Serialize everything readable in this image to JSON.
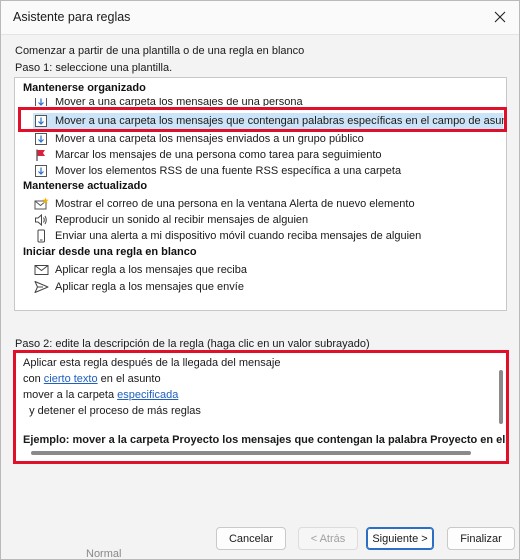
{
  "window": {
    "title": "Asistente para reglas"
  },
  "intro": "Comenzar a partir de una plantilla o de una regla en blanco",
  "step1": "Paso 1: seleccione una plantilla.",
  "groups": [
    {
      "header": "Mantenerse organizado"
    },
    {
      "header": "Mantenerse actualizado"
    },
    {
      "header": "Iniciar desde una regla en blanco"
    }
  ],
  "templates": [
    {
      "label": "Mover a una carpeta los mensajes de una persona",
      "icon": "envelope-arrow-icon"
    },
    {
      "label": "Mover a una carpeta los mensajes que contengan palabras específicas en el campo de asunto",
      "icon": "envelope-arrow-icon",
      "selected": true
    },
    {
      "label": "Mover a una carpeta los mensajes enviados a un grupo público",
      "icon": "envelope-arrow-icon"
    },
    {
      "label": "Marcar los mensajes de una persona como tarea para seguimiento",
      "icon": "red-flag-icon"
    },
    {
      "label": "Mover los elementos RSS de una fuente RSS específica a una carpeta",
      "icon": "envelope-arrow-icon"
    },
    {
      "label": "Mostrar el correo de una persona en la ventana Alerta de nuevo elemento",
      "icon": "star-envelope-icon"
    },
    {
      "label": "Reproducir un sonido al recibir mensajes de alguien",
      "icon": "speaker-icon"
    },
    {
      "label": "Enviar una alerta a mi dispositivo móvil cuando reciba mensajes de alguien",
      "icon": "mobile-phone-icon"
    },
    {
      "label": "Aplicar regla a los mensajes que reciba",
      "icon": "envelope-icon"
    },
    {
      "label": "Aplicar regla a los mensajes que envíe",
      "icon": "send-icon"
    }
  ],
  "step2": "Paso 2: edite la descripción de la regla (haga clic en un valor subrayado)",
  "description": {
    "line1": "Aplicar esta regla después de la llegada del mensaje",
    "line2_pre": "con ",
    "line2_link": "cierto texto",
    "line2_post": " en el asunto",
    "line3_pre": "mover a la carpeta ",
    "line3_link": "especificada",
    "line4": "  y detener el proceso de más reglas",
    "example": "Ejemplo: mover a la carpeta Proyecto los mensajes que contengan la palabra Proyecto en el asu"
  },
  "buttons": {
    "cancel": "Cancelar",
    "back": "< Atrás",
    "next": "Siguiente >",
    "finish": "Finalizar"
  },
  "background_text": "Normal"
}
